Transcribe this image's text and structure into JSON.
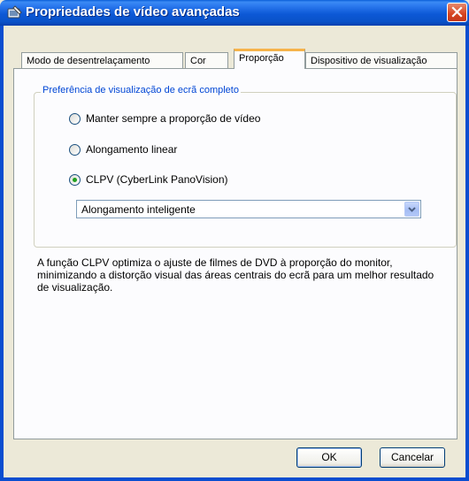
{
  "window": {
    "title": "Propriedades de vídeo avançadas"
  },
  "tabs": [
    {
      "label": "Modo de desentrelaçamento",
      "active": false
    },
    {
      "label": "Cor",
      "active": false
    },
    {
      "label": "Proporção",
      "active": true
    },
    {
      "label": "Dispositivo de visualização",
      "active": false
    }
  ],
  "group": {
    "legend": "Preferência de visualização de ecrã completo",
    "options": [
      {
        "label": "Manter sempre a proporção de vídeo",
        "selected": false
      },
      {
        "label": "Alongamento linear",
        "selected": false
      },
      {
        "label": "CLPV (CyberLink PanoVision)",
        "selected": true
      }
    ],
    "dropdown": {
      "selected": "Alongamento inteligente"
    }
  },
  "description": "A função CLPV optimiza o ajuste de filmes de DVD à proporção do monitor, minimizando a distorção visual das áreas centrais do ecrã para um melhor resultado de visualização.",
  "buttons": {
    "ok": "OK",
    "cancel": "Cancelar"
  },
  "colors": {
    "titlebar": "#0a52c8",
    "legend": "#0046d5",
    "active_tab_accent": "#f6b34a",
    "radio_dot": "#21a121"
  }
}
